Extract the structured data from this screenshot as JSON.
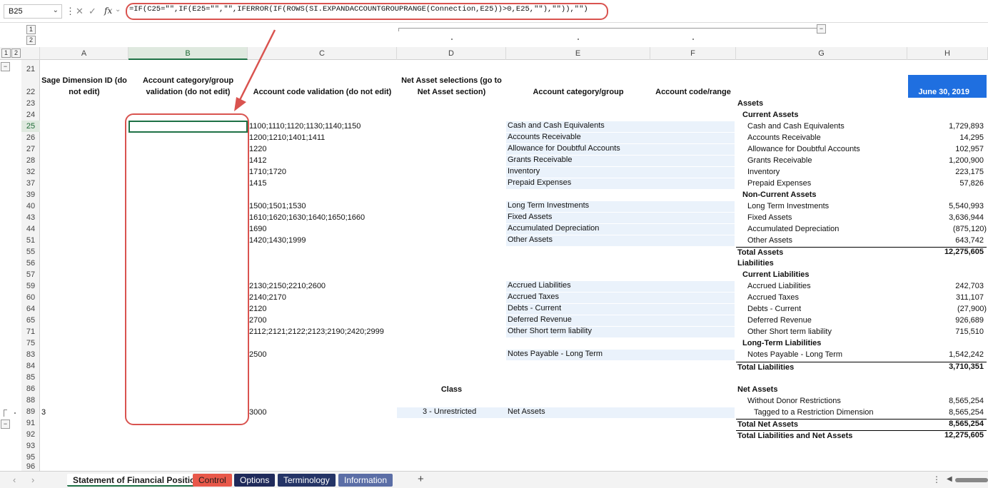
{
  "formula_bar": {
    "name_box": "B25",
    "formula": "=IF(C25=\"\",IF(E25=\"\",\"\",IFERROR(IF(ROWS(SI.EXPANDACCOUNTGROUPRANGE(Connection,E25))>0,E25,\"\"),\"\")),\"\")",
    "fx_label": "fx"
  },
  "outline": {
    "level1": "1",
    "level2": "2",
    "collapse": "−"
  },
  "columns": [
    "A",
    "B",
    "C",
    "D",
    "E",
    "F",
    "G",
    "H"
  ],
  "rows": [
    "21",
    "22",
    "23",
    "24",
    "25",
    "26",
    "27",
    "28",
    "32",
    "37",
    "39",
    "40",
    "43",
    "44",
    "51",
    "55",
    "56",
    "57",
    "59",
    "60",
    "64",
    "65",
    "71",
    "75",
    "83",
    "84",
    "85",
    "86",
    "88",
    "89",
    "91",
    "92",
    "93",
    "95",
    "96"
  ],
  "headers": {
    "a": "Sage Dimension ID (do not edit)",
    "b": "Account category/group validation (do not edit)",
    "c": "Account code validation (do not edit)",
    "d": "Net Asset selections (go to Net Asset section)",
    "e": "Account category/group",
    "f": "Account code/range",
    "h": "June 30, 2019"
  },
  "codes": {
    "r25": "1100;1110;1120;1130;1140;1150",
    "r26": "1200;1210;1401;1411",
    "r27": "1220",
    "r28": "1412",
    "r32": "1710;1720",
    "r37": "1415",
    "r40": "1500;1501;1530",
    "r43": "1610;1620;1630;1640;1650;1660",
    "r44": "1690",
    "r51": "1420;1430;1999",
    "r59": "2130;2150;2210;2600",
    "r60": "2140;2170",
    "r64": "2120",
    "r65": "2700",
    "r71": "2112;2121;2122;2123;2190;2420;2999",
    "r83": "2500",
    "r89": "3000"
  },
  "groups": {
    "r25": "Cash and Cash Equivalents",
    "r26": "Accounts Receivable",
    "r27": "Allowance for Doubtful Accounts",
    "r28": "Grants Receivable",
    "r32": "Inventory",
    "r37": "Prepaid Expenses",
    "r40": "Long Term Investments",
    "r43": "Fixed Assets",
    "r44": "Accumulated Depreciation",
    "r51": "Other Assets",
    "r59": "Accrued Liabilities",
    "r60": "Accrued Taxes",
    "r64": "Debts - Current",
    "r65": "Deferred Revenue",
    "r71": "Other Short term liability",
    "r83": "Notes Payable - Long Term",
    "r89": "Net Assets"
  },
  "class": {
    "label": "Class",
    "value": "3 - Unrestricted",
    "dim_id": "3"
  },
  "statement": {
    "assets": "Assets",
    "current_assets": "Current Assets",
    "noncurrent_assets": "Non-Current Assets",
    "total_assets": "Total Assets",
    "liabilities": "Liabilities",
    "current_liabilities": "Current Liabilities",
    "longterm_liabilities": "Long-Term Liabilities",
    "total_liabilities": "Total Liabilities",
    "net_assets": "Net Assets",
    "without_donor": "Without Donor Restrictions",
    "tagged": "Tagged to a Restriction Dimension",
    "total_net_assets": "Total Net Assets",
    "total_liab_net": "Total Liabilities and Net Assets"
  },
  "values": {
    "r25": "1,729,893",
    "r26": "14,295",
    "r27": "102,957",
    "r28": "1,200,900",
    "r32": "223,175",
    "r37": "57,826",
    "r40": "5,540,993",
    "r43": "3,636,944",
    "r44": "(875,120)",
    "r51": "643,742",
    "r55": "12,275,605",
    "r59": "242,703",
    "r60": "311,107",
    "r64": "(27,900)",
    "r65": "926,689",
    "r71": "715,510",
    "r83": "1,542,242",
    "r84": "3,710,351",
    "r88": "8,565,254",
    "r89": "8,565,254",
    "r91": "8,565,254",
    "r92": "12,275,605"
  },
  "tabs": {
    "t1": "Statement of Financial Position",
    "t2": "Control",
    "t3": "Options",
    "t4": "Terminology",
    "t5": "Information",
    "add": "+"
  },
  "colors": {
    "annotation": "#d9534f",
    "control_tab": "#e8584a",
    "options_tab": "#1f2a5a",
    "terminology_tab": "#243466",
    "information_tab": "#5b6ea6",
    "date_header": "#1f6fe0",
    "selected_green": "#1e7145"
  }
}
